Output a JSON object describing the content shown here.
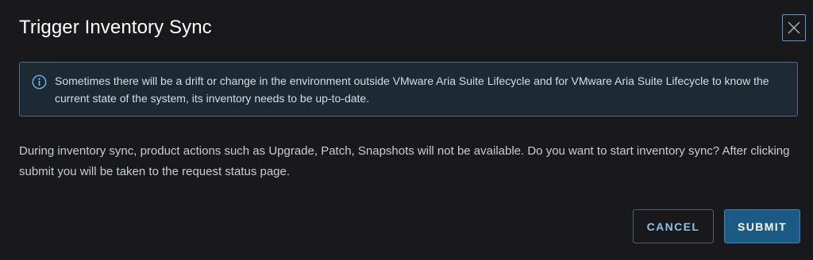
{
  "dialog": {
    "title": "Trigger Inventory Sync",
    "close_icon": "close-icon",
    "info_icon": "info-circle-icon",
    "info_message": "Sometimes there will be a drift or change in the environment outside VMware Aria Suite Lifecycle and for VMware Aria Suite Lifecycle to know the current state of the system, its inventory needs to be up-to-date.",
    "body_message": "During inventory sync, product actions such as Upgrade, Patch, Snapshots will not be available. Do you want to start inventory sync? After clicking submit you will be taken to the request status page.",
    "buttons": {
      "cancel_label": "CANCEL",
      "submit_label": "SUBMIT"
    }
  },
  "colors": {
    "background": "#19191b",
    "alert_background": "#1d2a33",
    "alert_border": "#4b6f86",
    "accent": "#4a9fd8",
    "primary_button": "#1c5a86"
  }
}
